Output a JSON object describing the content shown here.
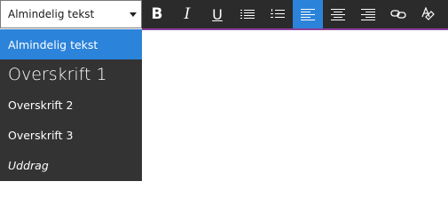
{
  "style_select": {
    "value": "Almindelig tekst"
  },
  "toolbar": {
    "active_color": "#2b83da",
    "buttons": [
      {
        "icon": "bold-icon",
        "label": "B",
        "active": false
      },
      {
        "icon": "italic-icon",
        "label": "I",
        "active": false
      },
      {
        "icon": "underline-icon",
        "label": "U",
        "active": false
      },
      {
        "icon": "bullet-list-icon",
        "active": false
      },
      {
        "icon": "numbered-list-icon",
        "active": false
      },
      {
        "icon": "align-left-icon",
        "active": true
      },
      {
        "icon": "align-center-icon",
        "active": false
      },
      {
        "icon": "align-right-icon",
        "active": false
      },
      {
        "icon": "link-icon",
        "active": false
      },
      {
        "icon": "clear-format-icon",
        "active": false
      }
    ]
  },
  "dropdown": {
    "items": [
      {
        "label": "Almindelig tekst",
        "selected": true
      },
      {
        "label": "Overskrift 1",
        "selected": false
      },
      {
        "label": "Overskrift 2",
        "selected": false
      },
      {
        "label": "Overskrift 3",
        "selected": false
      },
      {
        "label": "Uddrag",
        "selected": false
      }
    ]
  },
  "colors": {
    "toolbar_bg": "#2b2b2b",
    "dropdown_bg": "#333333",
    "accent": "#2b83da",
    "divider": "#8b3f9c"
  }
}
